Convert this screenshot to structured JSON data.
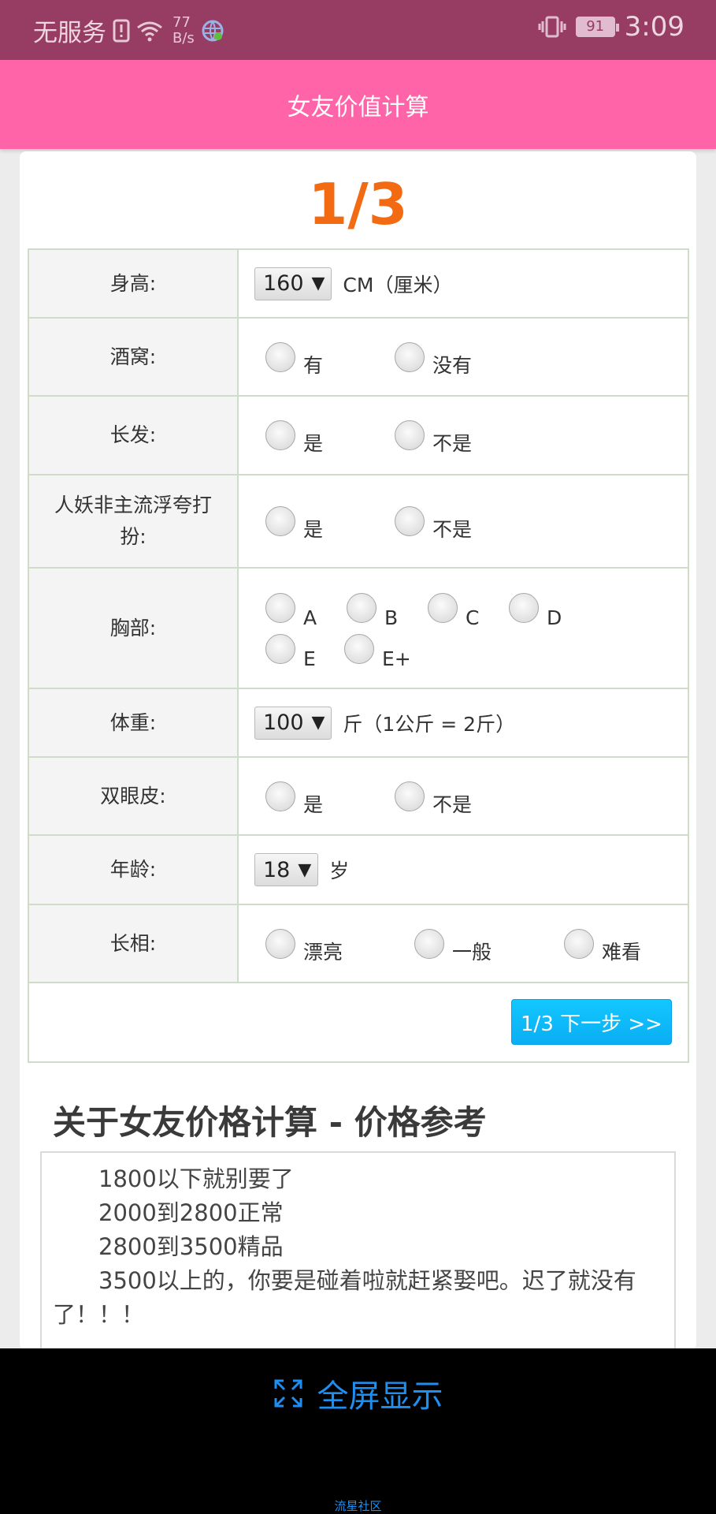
{
  "status_bar": {
    "carrier": "无服务",
    "speed_value": "77",
    "speed_unit": "B/s",
    "battery": "91",
    "time": "3:09"
  },
  "app": {
    "title": "女友价值计算"
  },
  "step": "1/3",
  "rows": {
    "height": {
      "label": "身高:",
      "value": "160",
      "unit": "CM（厘米）"
    },
    "dimples": {
      "label": "酒窝:",
      "options": [
        "有",
        "没有"
      ]
    },
    "long_hair": {
      "label": "长发:",
      "options": [
        "是",
        "不是"
      ]
    },
    "style": {
      "label": "人妖非主流浮夸打扮:",
      "options": [
        "是",
        "不是"
      ]
    },
    "chest": {
      "label": "胸部:",
      "options": [
        "A",
        "B",
        "C",
        "D",
        "E",
        "E+"
      ]
    },
    "weight": {
      "label": "体重:",
      "value": "100",
      "unit": "斤（1公斤 = 2斤）"
    },
    "double_eyelid": {
      "label": "双眼皮:",
      "options": [
        "是",
        "不是"
      ]
    },
    "age": {
      "label": "年龄:",
      "value": "18",
      "unit": "岁"
    },
    "looks": {
      "label": "长相:",
      "options": [
        "漂亮",
        "一般",
        "难看"
      ]
    }
  },
  "next_button": "1/3 下一步 >>",
  "about": {
    "title": "关于女友价格计算 - 价格参考",
    "lines": [
      "1800以下就别要了",
      "2000到2800正常",
      "2800到3500精品",
      "3500以上的，你要是碰着啦就赶紧娶吧。迟了就没有了！！！"
    ]
  },
  "bottom": {
    "fullscreen": "全屏显示",
    "watermark": "流星社区"
  },
  "colors": {
    "status_bar": "#973c63",
    "app_bar": "#ff63a8",
    "step": "#f26a12",
    "button": "#0aaef4",
    "link": "#1e8ff0"
  },
  "icons": [
    "wifi-icon",
    "alert-icon",
    "globe-icon",
    "vibrate-icon",
    "fullscreen-icon"
  ]
}
